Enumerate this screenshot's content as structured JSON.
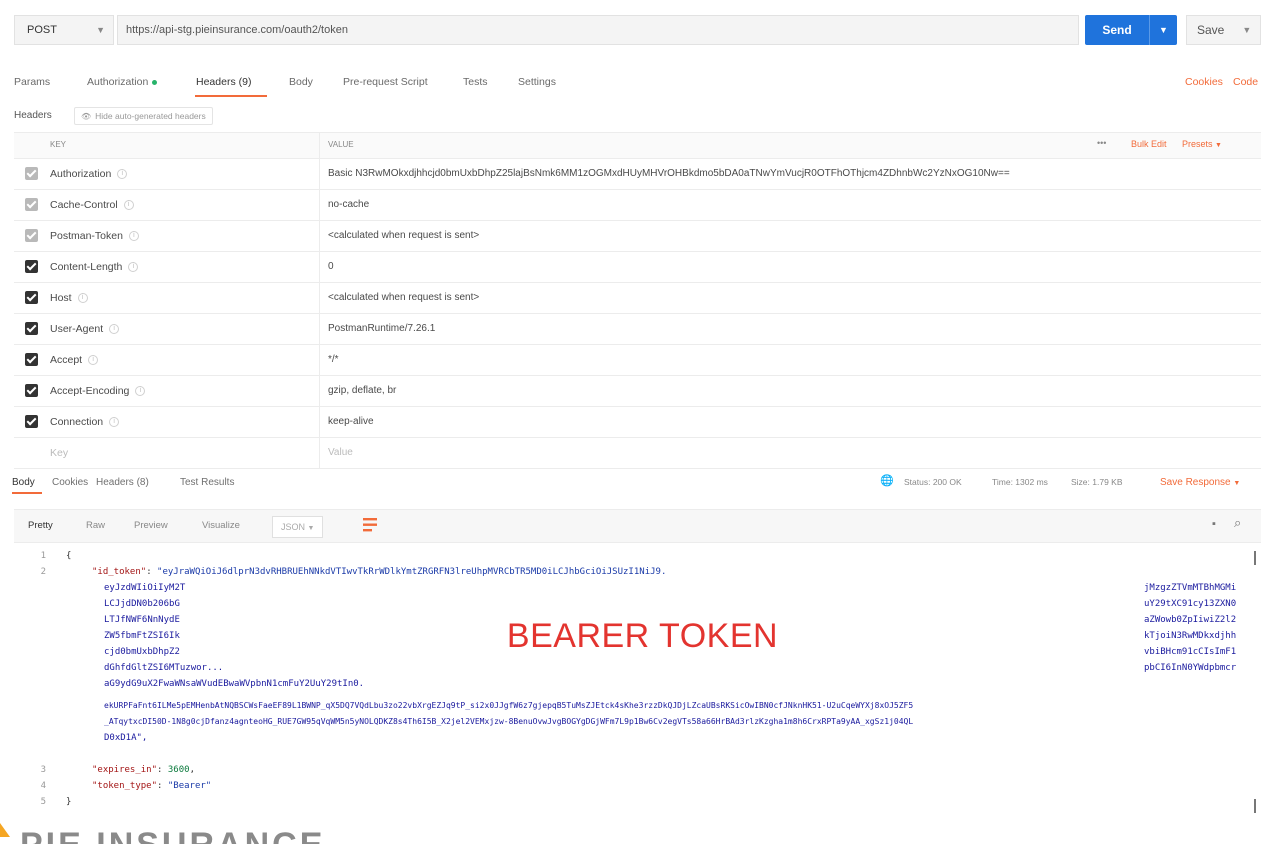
{
  "request": {
    "method": "POST",
    "url": "https://api-stg.pieinsurance.com/oauth2/token",
    "send_label": "Send",
    "save_label": "Save"
  },
  "tabs": {
    "params": "Params",
    "authorization": "Authorization",
    "headers": "Headers (9)",
    "body": "Body",
    "prerequest": "Pre-request Script",
    "tests": "Tests",
    "settings": "Settings",
    "cookies": "Cookies",
    "code": "Code"
  },
  "headers_bar": {
    "label": "Headers",
    "hide_button": "Hide auto-generated headers"
  },
  "table": {
    "col_key": "KEY",
    "col_value": "VALUE",
    "more": "•••",
    "bulk_edit": "Bulk Edit",
    "presets": "Presets",
    "rows": [
      {
        "key": "Authorization",
        "value": "Basic N3RwMOkxdjhhcjd0bmUxbDhpZ25lajBsNmk6MM1zOGMxdHUyMHVrOHBkdmo5bDA0aTNwYmVucjR0OTFhOThjcm4ZDhnbWc2YzNxOG10Nw==",
        "checked": "dim"
      },
      {
        "key": "Cache-Control",
        "value": "no-cache",
        "checked": "dim"
      },
      {
        "key": "Postman-Token",
        "value": "<calculated when request is sent>",
        "checked": "dim"
      },
      {
        "key": "Content-Length",
        "value": "0",
        "checked": "on"
      },
      {
        "key": "Host",
        "value": "<calculated when request is sent>",
        "checked": "on"
      },
      {
        "key": "User-Agent",
        "value": "PostmanRuntime/7.26.1",
        "checked": "on"
      },
      {
        "key": "Accept",
        "value": "*/*",
        "checked": "on"
      },
      {
        "key": "Accept-Encoding",
        "value": "gzip, deflate, br",
        "checked": "on"
      },
      {
        "key": "Connection",
        "value": "keep-alive",
        "checked": "on"
      }
    ],
    "new_key_placeholder": "Key",
    "new_value_placeholder": "Value"
  },
  "response": {
    "tabs": {
      "body": "Body",
      "cookies": "Cookies",
      "headers": "Headers (8)",
      "test_results": "Test Results"
    },
    "status": "Status: 200 OK",
    "time": "Time: 1302 ms",
    "size": "Size: 1.79 KB",
    "save_response": "Save Response",
    "toolbar": {
      "pretty": "Pretty",
      "raw": "Raw",
      "preview": "Preview",
      "visualize": "Visualize",
      "format": "JSON"
    },
    "code": {
      "line1": "{",
      "id_token_key": "\"id_token\"",
      "id_token_first": "\"eyJraWQiOiJ6dlprN3dvRHBRUEhNNkdVTIwvTkRrWDlkYmtZRGRFN3lreUhpMVRCbTR5MD0iLCJhbGciOiJSUzI1NiJ9.",
      "wrap_line_a": "eyJzdWIiOiIyM2T",
      "wrap_line_a_end": "jMzgzZTVmMTBhMGMi",
      "wrap_left": [
        "LCJjdDN0b206bG",
        "LTJfNWF6NnNydE",
        "ZW5fbmFtZSI6Ik",
        "cjd0bmUxbDhpZ2"
      ],
      "wrap_right": [
        "uY29tXC91cy13ZXN0",
        "aZWowb0ZpIiwiZ2l2",
        "kTjoiN3RwMDkxdjhh",
        "vbiBHcm91cCIsImF1"
      ],
      "wrap_line_b": "dGhfdGltZSI6MTuzwor...",
      "wrap_line_b_end": "pbCI6InN0YWdpbmcr",
      "wrap_line_c": "aG9ydG9uX2FwaWNsaWVudEBwaWVpbnN1cmFuY2UuY29tIn0.",
      "wrap_line_d": "ekURPFaFnt6ILMe5pEMHenbAtNQBSCWsFaeEF89L1BWNP_qX5DQ7VQdLbu3zo22vbXrgEZJq9tP_si2x0JJgfW6z7gjepqB5TuMsZJEtck4sKhe3rzzDkQJDjLZcaUBsRKSicOwIBN0cfJNknHK51-U2uCqeWYXj8xOJ5ZF5",
      "wrap_line_e": "_ATqytxcDI50D-1N8g0cjDfanz4agnteoHG_RUE7GW95qVqWM5n5yNOLQDKZ8s4Th6I5B_X2jel2VEMxjzw-8BenuOvwJvgBOGYgDGjWFm7L9p1Bw6Cv2egVTs58a66HrBAd3rlzKzgha1m8h6CrxRPTa9yAA_xgSz1j04QL",
      "wrap_line_f": "D0xD1A\",",
      "expires_key": "\"expires_in\"",
      "expires_val": "3600",
      "type_key": "\"token_type\"",
      "type_val": "\"Bearer\"",
      "line5": "}",
      "line_numbers": [
        "1",
        "2",
        "3",
        "4",
        "5"
      ]
    },
    "overlay": "BEARER TOKEN"
  },
  "footer": {
    "brand": "PIE INSURANCE"
  }
}
